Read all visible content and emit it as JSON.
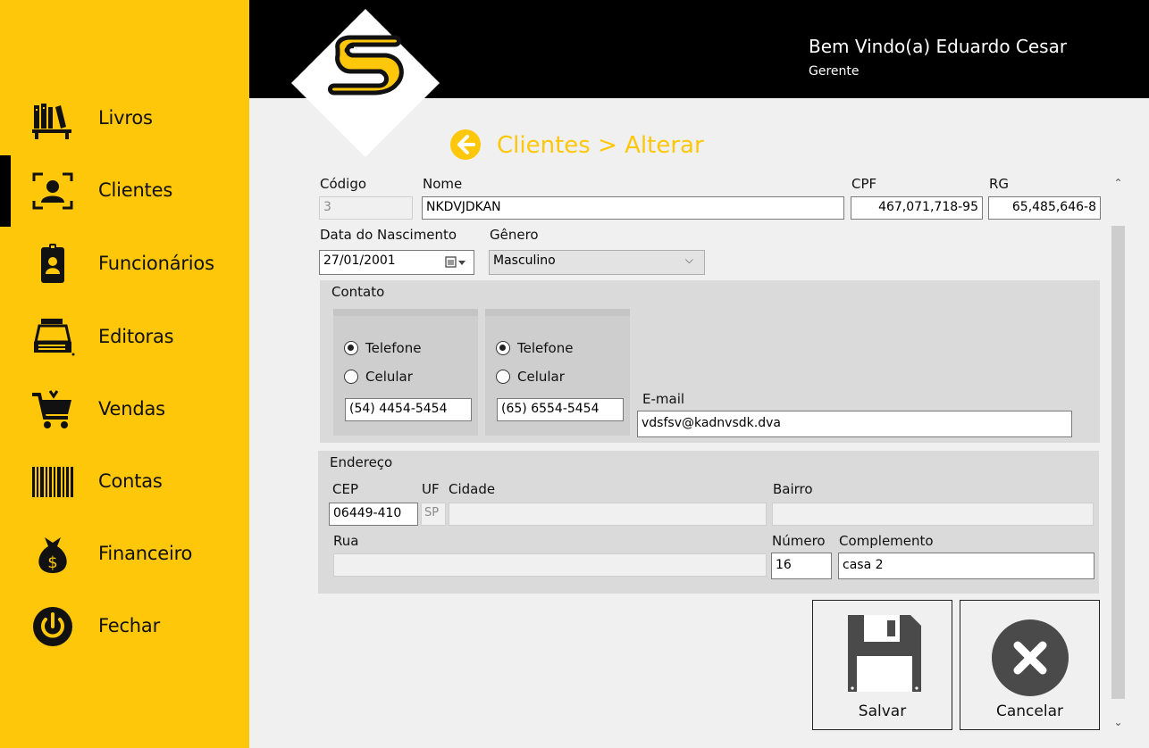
{
  "sidebar": {
    "items": [
      {
        "label": "Livros",
        "icon": "books-icon"
      },
      {
        "label": "Clientes",
        "icon": "client-id-icon"
      },
      {
        "label": "Funcionários",
        "icon": "employee-badge-icon"
      },
      {
        "label": "Editoras",
        "icon": "typewriter-icon"
      },
      {
        "label": "Vendas",
        "icon": "shopping-cart-icon"
      },
      {
        "label": "Contas",
        "icon": "barcode-icon"
      },
      {
        "label": "Financeiro",
        "icon": "money-bag-icon"
      },
      {
        "label": "Fechar",
        "icon": "power-icon"
      }
    ],
    "active": "Clientes"
  },
  "header": {
    "welcome": "Bem Vindo(a) Eduardo Cesar",
    "role": "Gerente"
  },
  "breadcrumb": "Clientes > Alterar",
  "form": {
    "codigo_label": "Código",
    "codigo_value": "3",
    "nome_label": "Nome",
    "nome_value": "NKDVJDKAN",
    "cpf_label": "CPF",
    "cpf_value": "467,071,718-95",
    "rg_label": "RG",
    "rg_value": "65,485,646-8",
    "nascimento_label": "Data do Nascimento",
    "nascimento_value": "27/01/2001",
    "genero_label": "Gênero",
    "genero_value": "Masculino"
  },
  "contato": {
    "title": "Contato",
    "phones": [
      {
        "option1": "Telefone",
        "option2": "Celular",
        "selected": "Telefone",
        "value": "(54) 4454-5454"
      },
      {
        "option1": "Telefone",
        "option2": "Celular",
        "selected": "Telefone",
        "value": "(65) 6554-5454"
      }
    ],
    "email_label": "E-mail",
    "email_value": "vdsfsv@kadnvsdk.dva"
  },
  "endereco": {
    "title": "Endereço",
    "cep_label": "CEP",
    "cep_value": "06449-410",
    "uf_label": "UF",
    "uf_value": "SP",
    "cidade_label": "Cidade",
    "cidade_value": "",
    "bairro_label": "Bairro",
    "bairro_value": "",
    "rua_label": "Rua",
    "rua_value": "",
    "numero_label": "Número",
    "numero_value": "16",
    "complemento_label": "Complemento",
    "complemento_value": "casa 2"
  },
  "actions": {
    "save_label": "Salvar",
    "cancel_label": "Cancelar"
  },
  "colors": {
    "accent": "#fec70a",
    "header_bg": "#000000",
    "panel_bg": "#dadada"
  }
}
